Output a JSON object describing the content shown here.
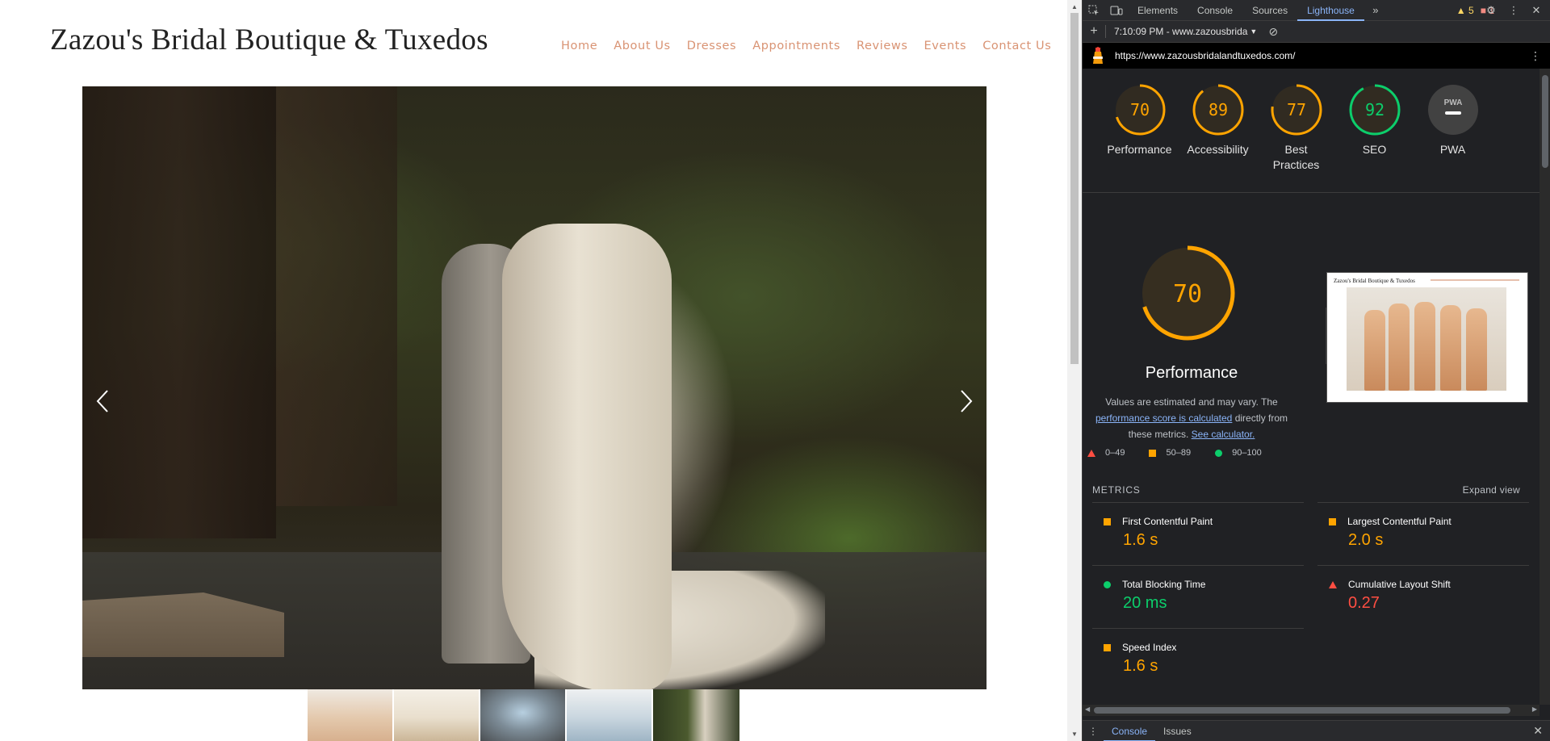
{
  "site": {
    "title": "Zazou's Bridal Boutique & Tuxedos",
    "nav": [
      "Home",
      "About Us",
      "Dresses",
      "Appointments",
      "Reviews",
      "Events",
      "Contact Us"
    ],
    "nav_color": "#d99373"
  },
  "devtools": {
    "tabs": [
      "Elements",
      "Console",
      "Sources",
      "Lighthouse"
    ],
    "active_tab": "Lighthouse",
    "warnings_count": "5",
    "errors_count": "1",
    "report_time": "7:10:09 PM - www.zazousbrida",
    "url": "https://www.zazousbridalandtuxedos.com/",
    "drawer_tabs": [
      "Console",
      "Issues"
    ]
  },
  "lighthouse": {
    "gauges": [
      {
        "label": "Performance",
        "score": 70,
        "color": "#ffa400"
      },
      {
        "label": "Accessibility",
        "score": 89,
        "color": "#ffa400"
      },
      {
        "label": "Best Practices",
        "score": 77,
        "color": "#ffa400"
      },
      {
        "label": "SEO",
        "score": 92,
        "color": "#0cce6b"
      },
      {
        "label": "PWA",
        "score": null,
        "color": "#9aa0a6"
      }
    ],
    "pwa_badge": "PWA",
    "performance": {
      "score": 70,
      "title": "Performance",
      "note_prefix": "Values are estimated and may vary. The ",
      "note_link1": "performance score is calculated",
      "note_mid": " directly from these metrics. ",
      "note_link2": "See calculator."
    },
    "legend": [
      "0–49",
      "50–89",
      "90–100"
    ],
    "metrics_heading": "METRICS",
    "expand_label": "Expand view",
    "metrics": [
      {
        "name": "First Contentful Paint",
        "value": "1.6 s",
        "rating": "average",
        "color": "#ffa400"
      },
      {
        "name": "Largest Contentful Paint",
        "value": "2.0 s",
        "rating": "average",
        "color": "#ffa400"
      },
      {
        "name": "Total Blocking Time",
        "value": "20 ms",
        "rating": "pass",
        "color": "#0cce6b"
      },
      {
        "name": "Cumulative Layout Shift",
        "value": "0.27",
        "rating": "fail",
        "color": "#ff4e42"
      },
      {
        "name": "Speed Index",
        "value": "1.6 s",
        "rating": "average",
        "color": "#ffa400"
      }
    ]
  }
}
